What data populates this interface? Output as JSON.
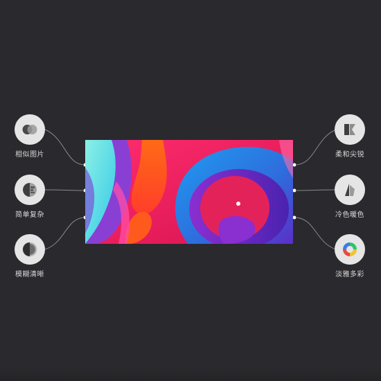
{
  "features_left": [
    {
      "label": "相似图片",
      "icon": "similar-circles-icon"
    },
    {
      "label": "简单复杂",
      "icon": "simple-complex-icon"
    },
    {
      "label": "模糊清晰",
      "icon": "blur-sharp-icon"
    }
  ],
  "features_right": [
    {
      "label": "柔和尖锐",
      "icon": "soft-sharp-icon"
    },
    {
      "label": "冷色暖色",
      "icon": "cool-warm-icon"
    },
    {
      "label": "淡雅多彩",
      "icon": "muted-colorful-icon"
    }
  ],
  "colors": {
    "background": "#2a292d",
    "disc": "#e5e5e5",
    "wire": "#8a8a8e",
    "label": "#d9d9d9",
    "art_magenta": "#e0195e",
    "art_purple": "#6a1fb8",
    "art_cyan": "#3bd3e6",
    "art_orange": "#ff4a1a"
  }
}
